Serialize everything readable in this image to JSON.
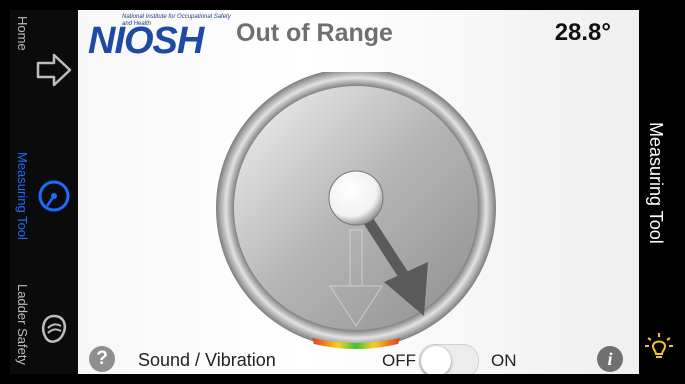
{
  "left_nav": {
    "items": [
      {
        "label": "Home",
        "icon": "home-arrow-icon",
        "active": false
      },
      {
        "label": "Measuring Tool",
        "icon": "gauge-icon",
        "active": true
      },
      {
        "label": "Ladder Safety",
        "icon": "ladder-safety-icon",
        "active": false
      }
    ]
  },
  "header": {
    "logo_text": "NIOSH",
    "logo_subtext": "National Institute for Occupational Safety and Health",
    "status": "Out of Range",
    "angle": "28.8°"
  },
  "gauge": {
    "needle_icon": "arrow-needle-icon",
    "target_icon": "target-arrow-icon",
    "indicator_colors": [
      "#e23a2a",
      "#f7d21c",
      "#3cc13b",
      "#f7d21c",
      "#e23a2a"
    ]
  },
  "footer": {
    "sound_icon": "question-icon",
    "sound_label": "Sound / Vibration",
    "off_label": "OFF",
    "on_label": "ON",
    "toggle_state": "off",
    "info_icon": "info-icon"
  },
  "right_panel": {
    "title": "Measuring Tool",
    "light_icon": "lightbulb-icon"
  },
  "colors": {
    "accent": "#1E6BFF",
    "logo": "#1C4AA6",
    "bulb": "#F2C230"
  }
}
